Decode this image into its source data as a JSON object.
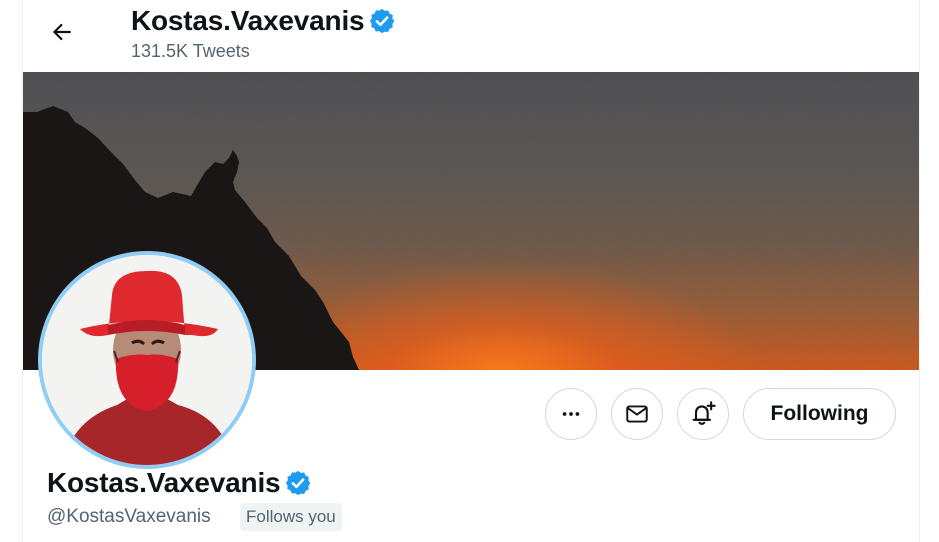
{
  "header": {
    "name": "Kostas.Vaxevanis",
    "tweet_count": "131.5K Tweets",
    "back_icon": "arrow-left-icon"
  },
  "profile": {
    "name": "Kostas.Vaxevanis",
    "handle": "@KostasVaxevanis",
    "follows_you_label": "Follows you",
    "verified_icon": "verified-badge-icon"
  },
  "actions": {
    "more_icon": "more-icon",
    "message_icon": "mail-icon",
    "notify_icon": "bell-plus-icon",
    "following_label": "Following"
  },
  "colors": {
    "verified": "#1d9bf0",
    "avatar_ring": "#8ecdf5",
    "muted_text": "#536471",
    "border": "#cfd9de"
  }
}
